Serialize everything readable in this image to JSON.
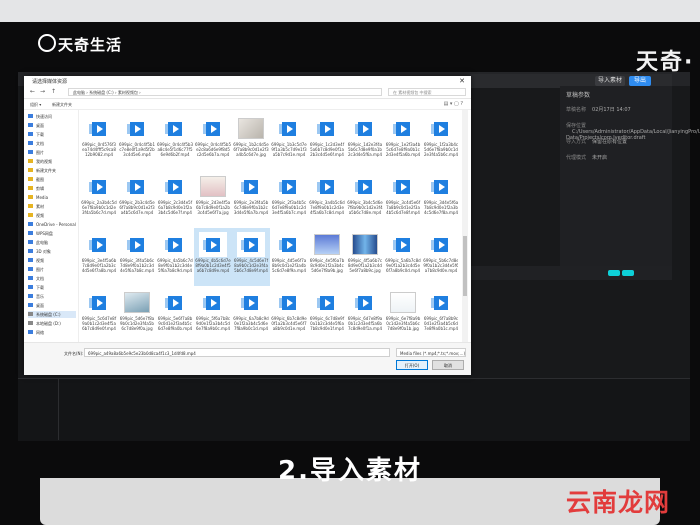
{
  "watermarks": {
    "top_left": "天奇生活",
    "top_right": "天奇·",
    "bottom_right": "云南龙网"
  },
  "caption": "2.导入素材",
  "editor": {
    "import_label": "导入素材",
    "export_label": "导出",
    "panel_title": "草稿参数",
    "props": [
      {
        "k": "草稿名称",
        "v": "02月17日 14:07"
      },
      {
        "k": "保存位置",
        "v": "C:/Users/Administrator/AppData/Local/JianyingPro/User Data/Projects/com.lveditor.draft"
      },
      {
        "k": "导入方式",
        "v": "保留在原有位置"
      },
      {
        "k": "代理模式",
        "v": "未开启"
      }
    ]
  },
  "dialog": {
    "title": "请选择媒体资源",
    "close": "✕",
    "address": "此电脑 › 系统磁盘 (C:) › 素材视频包 ›",
    "search_placeholder": "在 素材视频包 中搜索",
    "toolbar_organize": "组织 ▾",
    "toolbar_newfolder": "新建文件夹",
    "sidebar": [
      {
        "label": "快速访问",
        "color": "#3b7ddd"
      },
      {
        "label": "桌面",
        "color": "#3b7ddd"
      },
      {
        "label": "下载",
        "color": "#3b7ddd"
      },
      {
        "label": "文档",
        "color": "#3b7ddd"
      },
      {
        "label": "图片",
        "color": "#3b7ddd"
      },
      {
        "label": "我的视频",
        "color": "#e6b422"
      },
      {
        "label": "新建文件夹",
        "color": "#e6b422"
      },
      {
        "label": "截图",
        "color": "#e6b422"
      },
      {
        "label": "剪辑",
        "color": "#e6b422"
      },
      {
        "label": "Media",
        "color": "#e6b422"
      },
      {
        "label": "素材",
        "color": "#e6b422"
      },
      {
        "label": "视频",
        "color": "#e6b422"
      },
      {
        "label": "OneDrive - Personal",
        "color": "#3b7ddd"
      },
      {
        "label": "WPS网盘",
        "color": "#3b7ddd"
      },
      {
        "label": "此电脑",
        "color": "#3b7ddd"
      },
      {
        "label": "3D 对象",
        "color": "#3b7ddd"
      },
      {
        "label": "视频",
        "color": "#3b7ddd"
      },
      {
        "label": "图片",
        "color": "#3b7ddd"
      },
      {
        "label": "文档",
        "color": "#3b7ddd"
      },
      {
        "label": "下载",
        "color": "#3b7ddd"
      },
      {
        "label": "音乐",
        "color": "#3b7ddd"
      },
      {
        "label": "桌面",
        "color": "#3b7ddd"
      },
      {
        "label": "系统磁盘 (C:)",
        "color": "#888888"
      },
      {
        "label": "本地磁盘 (D:)",
        "color": "#888888"
      },
      {
        "label": "网络",
        "color": "#3b7ddd"
      }
    ],
    "files": [
      {
        "name": "699pic_0r4576f3ea74d4fff5c9ca812b9082.mp4",
        "kind": "video"
      },
      {
        "name": "699pic_0r4c4f5b1c7e8e0f1a9d5f2b3c4d5e6.mp4",
        "kind": "video"
      },
      {
        "name": "699pic_0r4c4f5b3a8c4e5f1d6c77f56e9d6b2f.mp4",
        "kind": "video"
      },
      {
        "name": "699pic_0r4c4f5b5e2c8a6d6e9f8d5c2d5e6b7a.mp4",
        "kind": "video"
      },
      {
        "name": "699pic_1b2c4d5e6f7a8b9c0d1e2f3a4b5c6d7e.jpg",
        "kind": "image",
        "g": "g1"
      },
      {
        "name": "699pic_1b3c5d7e9f1a3b5c7d9e1f3a5b7c9d1e.mp4",
        "kind": "video"
      },
      {
        "name": "699pic_1c2d3e4f5a6b7c8d9e0f1a2b3c4d5e6f.mp4",
        "kind": "video"
      },
      {
        "name": "699pic_1d2e3f4a5b6c7d8e9f0a1b2c3d4e5f6a.mp4",
        "kind": "video"
      },
      {
        "name": "699pic_1e2f3a4b5c6d7e8f9a0b1c2d3e4f5a6b.mp4",
        "kind": "video"
      },
      {
        "name": "699pic_1f2a3b4c5d6e7f8a9b0c1d2e3f4a5b6c.mp4",
        "kind": "video"
      },
      {
        "name": "699pic_2a3b4c5d6e7f8a9b0c1d2e3f4a5b6c7d.mp4",
        "kind": "video"
      },
      {
        "name": "699pic_2b3c4d5e6f7a8b9c0d1e2f3a4b5c6d7e.mp4",
        "kind": "video"
      },
      {
        "name": "699pic_2c3d4e5f6a7b8c9d0e1f2a3b4c5d6e7f.mp4",
        "kind": "video"
      },
      {
        "name": "699pic_2d3e4f5a6b7c8d9e0f1a2b3c4d5e6f7a.jpg",
        "kind": "image",
        "g": "g2"
      },
      {
        "name": "699pic_2e3f4a5b6c7d8e9f0a1b2c3d4e5f6a7b.mp4",
        "kind": "video"
      },
      {
        "name": "699pic_2f3a4b5c6d7e8f9a0b1c2d3e4f5a6b7c.mp4",
        "kind": "video"
      },
      {
        "name": "699pic_3a4b5c6d7e8f9a0b1c2d3e4f5a6b7c8d.mp4",
        "kind": "video"
      },
      {
        "name": "699pic_3b4c5d6e7f8a9b0c1d2e3f4a5b6c7d8e.mp4",
        "kind": "video"
      },
      {
        "name": "699pic_3c4d5e6f7a8b9c0d1e2f3a4b5c6d7e8f.mp4",
        "kind": "video"
      },
      {
        "name": "699pic_3d4e5f6a7b8c9d0e1f2a3b4c5d6e7f8a.mp4",
        "kind": "video"
      },
      {
        "name": "699pic_3e4f5a6b7c8d9e0f1a2b3c4d5e6f7a8b.mp4",
        "kind": "video"
      },
      {
        "name": "699pic_3f4a5b6c7d8e9f0a1b2c3d4e5f6a7b8c.mp4",
        "kind": "video"
      },
      {
        "name": "699pic_4a5b6c7d8e9f0a1b2c3d4e5f6a7b8c9d.mp4",
        "kind": "video"
      },
      {
        "name": "699pic_4b5c6d7e8f9a0b1c2d3e4f5a6b7c8d9e.mp4",
        "kind": "video",
        "sel": true
      },
      {
        "name": "699pic_4c5d6e7f8a9b0c1d2e3f4a5b6c7d8e9f.mp4",
        "kind": "video",
        "sel": true
      },
      {
        "name": "699pic_4d5e6f7a8b9c0d1e2f3a4b5c6d7e8f9a.mp4",
        "kind": "video"
      },
      {
        "name": "699pic_4e5f6a7b8c9d0e1f2a3b4c5d6e7f8a9b.jpg",
        "kind": "image",
        "g": "g3"
      },
      {
        "name": "699pic_4f5a6b7c8d9e0f1a2b3c4d5e6f7a8b9c.jpg",
        "kind": "image",
        "g": "g4"
      },
      {
        "name": "699pic_5a6b7c8d9e0f1a2b3c4d5e6f7a8b9c0d.mp4",
        "kind": "video"
      },
      {
        "name": "699pic_5b6c7d8e9f0a1b2c3d4e5f6a7b8c9d0e.mp4",
        "kind": "video"
      },
      {
        "name": "699pic_5c6d7e8f9a0b1c2d3e4f5a6b7c8d9e0f.mp4",
        "kind": "video"
      },
      {
        "name": "699pic_5d6e7f8a9b0c1d2e3f4a5b6c7d8e9f0a.jpg",
        "kind": "image",
        "g": "g6"
      },
      {
        "name": "699pic_5e6f7a8b9c0d1e2f3a4b5c6d7e8f9a0b.mp4",
        "kind": "video"
      },
      {
        "name": "699pic_5f6a7b8c9d0e1f2a3b4c5d6e7f8a9b0c.mp4",
        "kind": "video"
      },
      {
        "name": "699pic_6a7b8c9d0e1f2a3b4c5d6e7f8a9b0c1d.mp4",
        "kind": "video"
      },
      {
        "name": "699pic_6b7c8d9e0f1a2b3c4d5e6f7a8b9c0d1e.mp4",
        "kind": "video"
      },
      {
        "name": "699pic_6c7d8e9f0a1b2c3d4e5f6a7b8c9d0e1f.mp4",
        "kind": "video"
      },
      {
        "name": "699pic_6d7e8f9a0b1c2d3e4f5a6b7c8d9e0f1a.mp4",
        "kind": "video"
      },
      {
        "name": "699pic_6e7f8a9b0c1d2e3f4a5b6c7d8e9f0a1b.jpg",
        "kind": "image",
        "g": "g5"
      },
      {
        "name": "699pic_6f7a8b9c0d1e2f3a4b5c6d7e8f9a0b1c.mp4",
        "kind": "video"
      },
      {
        "name": "699pic_7a8b9c0d1e2f3a4b5c6d7e8f9a0b1c2d.mp4",
        "kind": "video"
      },
      {
        "name": "699pic_7b8c9d0e1f2a3b4c5d6e7f8a9b0c1d2e.mp4",
        "kind": "video"
      },
      {
        "name": "699pic_7c8d9e0f1a2b3c4d5e6f7a8b9c0d1e2f.jpg",
        "kind": "image",
        "g": "g7"
      },
      {
        "name": "699pic_7d8e9f0a1b2c3d4e5f6a7b8c9d0e1f2a.mp4",
        "kind": "video"
      },
      {
        "name": "699pic_7e8f9a0b1c2d3e4f5a6b7c8d9e0f1a2b.mp4",
        "kind": "video"
      },
      {
        "name": "699pic_7f8a9b0c1d2e3f4a5b6c7d8e9f0a1b2c.mp4",
        "kind": "video"
      },
      {
        "name": "699pic_8a9b0c1d2e3f4a5b6c7d8e9f0a1b2c3d.mp4",
        "kind": "video"
      },
      {
        "name": "699pic_8b9c0d1e2f3a4b5c6d7e8f9a0b1c2d3e.jpg",
        "kind": "image",
        "g": "g2"
      },
      {
        "name": "699pic_8c9d0e1f2a3b4c5d6e7f8a9b0c1d2e3f.mp4",
        "kind": "video"
      },
      {
        "name": "699pic_8d9e0f1a2b3c4d5e6f7a8b9c0d1e2f3a.mp4",
        "kind": "video"
      }
    ],
    "filename_label": "文件名(N):",
    "filename_value": "699pic_a49a8a6b5e9c5e23b0d8ca4f1c3_1d4fd8.mp4",
    "filetype_value": "Media files (*.mp4;*.ts;*.mov;…)",
    "open_label": "打开(O)",
    "cancel_label": "取消"
  }
}
